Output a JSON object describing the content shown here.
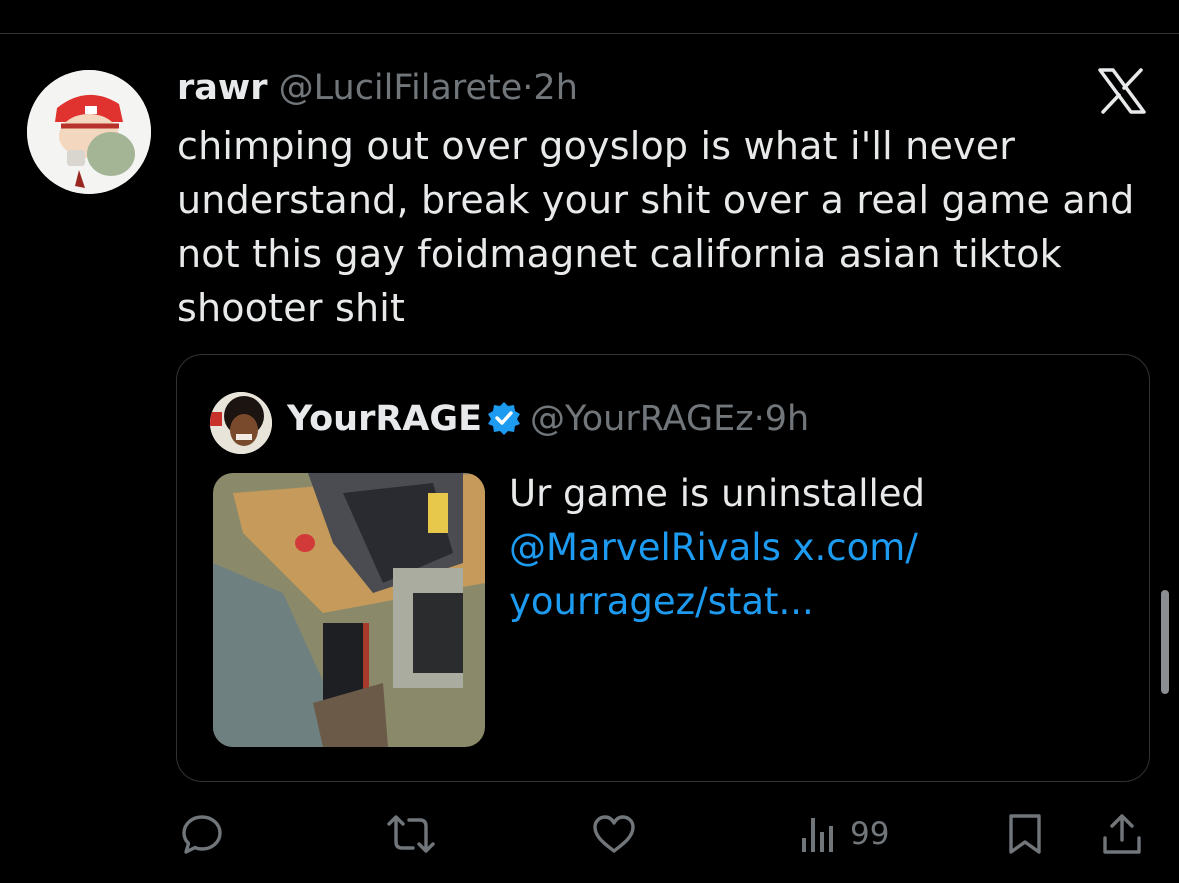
{
  "tweet": {
    "display_name": "rawr",
    "handle": "@LucilFilarete",
    "separator": "·",
    "time": "2h",
    "text": "chimping out over goyslop is what i'll never understand, break your shit over a real game and not this gay foidmagnet california asian tiktok shooter shit"
  },
  "quoted": {
    "display_name": "YourRAGE",
    "handle": "@YourRAGEz",
    "separator": "·",
    "time": "9h",
    "text": "Ur game is uninstalled",
    "mention": "@MarvelRivals",
    "link_part1": "x.com/",
    "link_part2": "yourragez/stat..."
  },
  "actions": {
    "views": "99"
  },
  "icons": [
    "x-logo-icon",
    "verified-badge-icon",
    "reply-icon",
    "retweet-icon",
    "like-icon",
    "views-icon",
    "bookmark-icon",
    "share-icon"
  ],
  "colors": {
    "background": "#000000",
    "text": "#e7e9ea",
    "muted": "#71767b",
    "link": "#1d9bf0",
    "border": "#2f3336"
  }
}
